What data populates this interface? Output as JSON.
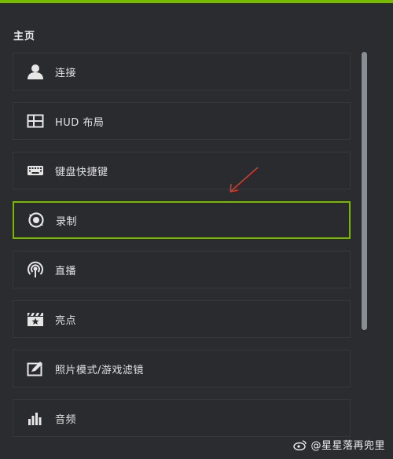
{
  "colors": {
    "accent": "#76b900",
    "background": "#2a2c30",
    "annotation_arrow": "#d13b2b"
  },
  "section_title": "主页",
  "menu": {
    "items": [
      {
        "label": "连接",
        "icon": "person-icon",
        "selected": false
      },
      {
        "label": "HUD 布局",
        "icon": "layout-grid-icon",
        "selected": false
      },
      {
        "label": "键盘快捷键",
        "icon": "keyboard-icon",
        "selected": false
      },
      {
        "label": "录制",
        "icon": "record-icon",
        "selected": true
      },
      {
        "label": "直播",
        "icon": "broadcast-icon",
        "selected": false
      },
      {
        "label": "亮点",
        "icon": "clapperboard-star-icon",
        "selected": false
      },
      {
        "label": "照片模式/游戏滤镜",
        "icon": "photo-edit-icon",
        "selected": false
      },
      {
        "label": "音频",
        "icon": "audio-equalizer-icon",
        "selected": false
      }
    ]
  },
  "watermark": {
    "text": "@星星落再兜里"
  }
}
